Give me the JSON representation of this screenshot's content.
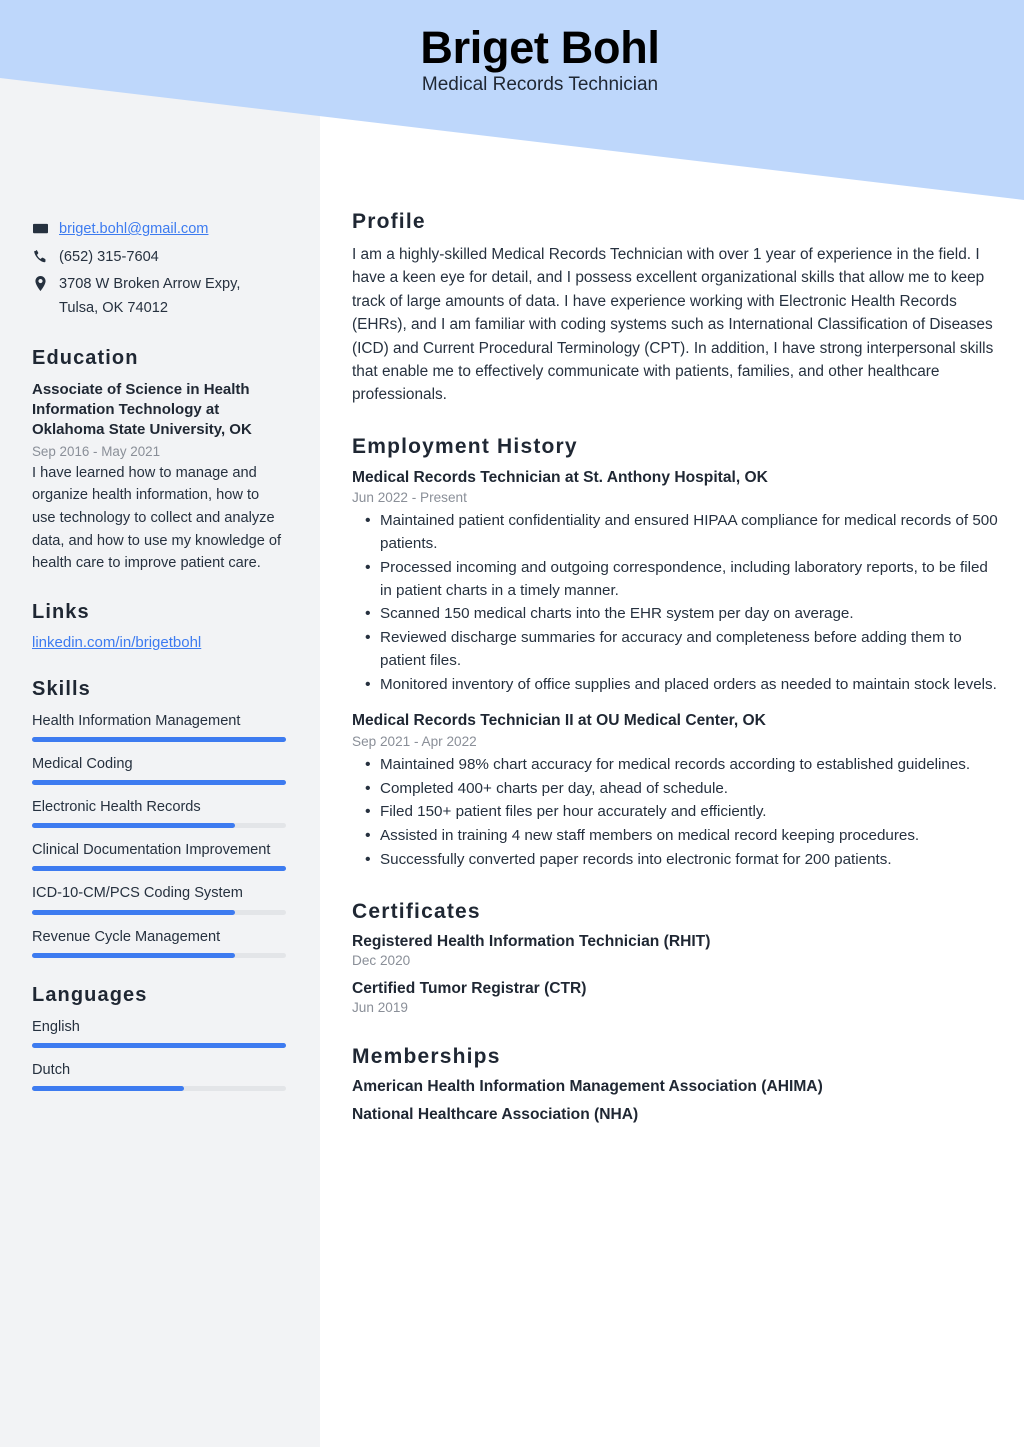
{
  "header": {
    "name": "Briget Bohl",
    "job_title": "Medical Records Technician",
    "banner_color": "#bed7fb"
  },
  "theme": {
    "accent": "#3d7bf0",
    "sidebar_bg": "#f2f3f5",
    "text": "#26313f",
    "muted": "#8a8f98"
  },
  "contact": {
    "email": "briget.bohl@gmail.com",
    "phone": "(652) 315-7604",
    "address_line1": "3708 W Broken Arrow Expy,",
    "address_line2": "Tulsa, OK 74012",
    "icons": {
      "email": "envelope-icon",
      "phone": "phone-icon",
      "address": "location-pin-icon"
    }
  },
  "education": {
    "heading": "Education",
    "entries": [
      {
        "title": "Associate of Science in Health Information Technology at Oklahoma State University, OK",
        "date": "Sep 2016 - May 2021",
        "description": "I have learned how to manage and organize health information, how to use technology to collect and analyze data, and how to use my knowledge of health care to improve patient care."
      }
    ]
  },
  "links": {
    "heading": "Links",
    "items": [
      {
        "label": "linkedin.com/in/brigetbohl"
      }
    ]
  },
  "skills": {
    "heading": "Skills",
    "items": [
      {
        "label": "Health Information Management",
        "level": 100
      },
      {
        "label": "Medical Coding",
        "level": 100
      },
      {
        "label": "Electronic Health Records",
        "level": 80
      },
      {
        "label": "Clinical Documentation Improvement",
        "level": 100
      },
      {
        "label": "ICD-10-CM/PCS Coding System",
        "level": 80
      },
      {
        "label": "Revenue Cycle Management",
        "level": 80
      }
    ]
  },
  "languages": {
    "heading": "Languages",
    "items": [
      {
        "label": "English",
        "level": 100
      },
      {
        "label": "Dutch",
        "level": 60
      }
    ]
  },
  "profile": {
    "heading": "Profile",
    "text": "I am a highly-skilled Medical Records Technician with over 1 year of experience in the field. I have a keen eye for detail, and I possess excellent organizational skills that allow me to keep track of large amounts of data. I have experience working with Electronic Health Records (EHRs), and I am familiar with coding systems such as International Classification of Diseases (ICD) and Current Procedural Terminology (CPT). In addition, I have strong interpersonal skills that enable me to effectively communicate with patients, families, and other healthcare professionals."
  },
  "employment": {
    "heading": "Employment History",
    "jobs": [
      {
        "title": "Medical Records Technician at St. Anthony Hospital, OK",
        "date": "Jun 2022 - Present",
        "bullets": [
          "Maintained patient confidentiality and ensured HIPAA compliance for medical records of 500 patients.",
          "Processed incoming and outgoing correspondence, including laboratory reports, to be filed in patient charts in a timely manner.",
          "Scanned 150 medical charts into the EHR system per day on average.",
          "Reviewed discharge summaries for accuracy and completeness before adding them to patient files.",
          "Monitored inventory of office supplies and placed orders as needed to maintain stock levels."
        ]
      },
      {
        "title": "Medical Records Technician II at OU Medical Center, OK",
        "date": "Sep 2021 - Apr 2022",
        "bullets": [
          "Maintained 98% chart accuracy for medical records according to established guidelines.",
          "Completed 400+ charts per day, ahead of schedule.",
          "Filed 150+ patient files per hour accurately and efficiently.",
          "Assisted in training 4 new staff members on medical record keeping procedures.",
          "Successfully converted paper records into electronic format for 200 patients."
        ]
      }
    ]
  },
  "certificates": {
    "heading": "Certificates",
    "items": [
      {
        "name": "Registered Health Information Technician (RHIT)",
        "date": "Dec 2020"
      },
      {
        "name": "Certified Tumor Registrar (CTR)",
        "date": "Jun 2019"
      }
    ]
  },
  "memberships": {
    "heading": "Memberships",
    "items": [
      {
        "name": "American Health Information Management Association (AHIMA)"
      },
      {
        "name": "National Healthcare Association (NHA)"
      }
    ]
  }
}
